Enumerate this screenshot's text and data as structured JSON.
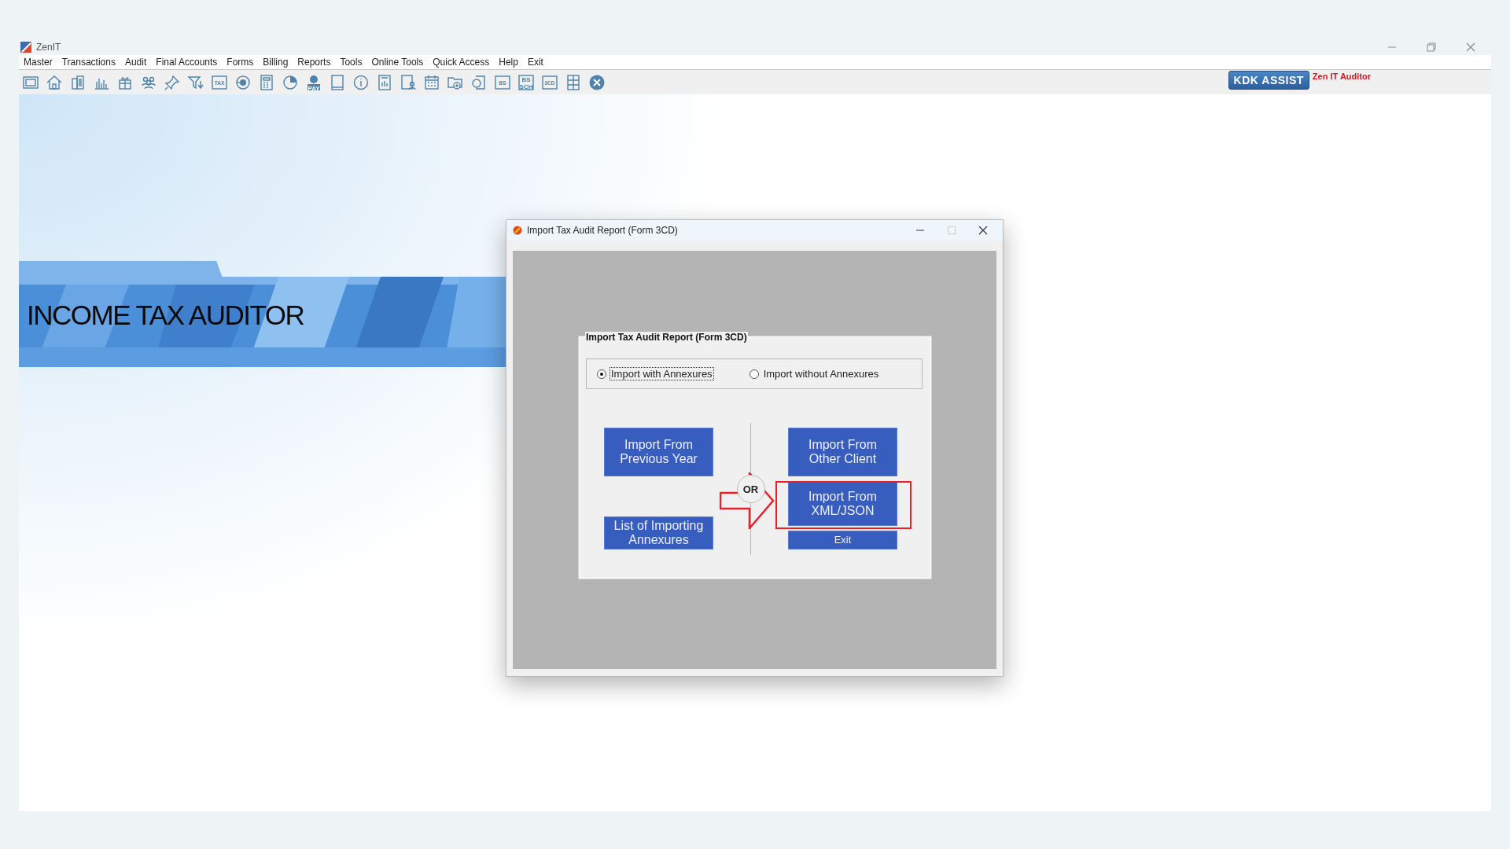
{
  "window": {
    "title": "ZenIT"
  },
  "menu": [
    "Master",
    "Transactions",
    "Audit",
    "Final Accounts",
    "Forms",
    "Billing",
    "Reports",
    "Tools",
    "Online Tools",
    "Quick Access",
    "Help",
    "Exit"
  ],
  "toolbar": [
    {
      "kind": "rupee"
    },
    {
      "kind": "home"
    },
    {
      "kind": "building"
    },
    {
      "kind": "chart"
    },
    {
      "kind": "gift"
    },
    {
      "kind": "people"
    },
    {
      "kind": "pin"
    },
    {
      "kind": "filter"
    },
    {
      "kind": "badge",
      "label": "TAX"
    },
    {
      "kind": "disc"
    },
    {
      "kind": "calculator"
    },
    {
      "kind": "pie"
    },
    {
      "kind": "pay",
      "label": "PAY"
    },
    {
      "kind": "book"
    },
    {
      "kind": "info"
    },
    {
      "kind": "report"
    },
    {
      "kind": "userdoc"
    },
    {
      "kind": "calendar"
    },
    {
      "kind": "folder"
    },
    {
      "kind": "docsearch"
    },
    {
      "kind": "badge",
      "label": "BS"
    },
    {
      "kind": "badge2",
      "label": "BS",
      "sub": "SCH"
    },
    {
      "kind": "badge",
      "label": "3CD"
    },
    {
      "kind": "grid"
    },
    {
      "kind": "close"
    }
  ],
  "assist_button": "KDK ASSIST",
  "product_name": "Zen IT Auditor",
  "banner": {
    "title": "INCOME TAX AUDITOR"
  },
  "dialog": {
    "title": "Import Tax Audit Report (Form 3CD)",
    "group_title": "Import Tax Audit Report (Form 3CD)",
    "options": [
      {
        "label": "Import with Annexures",
        "selected": true
      },
      {
        "label": "Import without Annexures",
        "selected": false
      }
    ],
    "left_buttons": [
      {
        "lines": [
          "Import From",
          "Previous Year"
        ],
        "highlighted": false
      },
      {
        "lines": [
          "List of Importing",
          "Annexures"
        ],
        "highlighted": false
      }
    ],
    "separator_label": "OR",
    "right_buttons": [
      {
        "lines": [
          "Import From",
          "Other Client"
        ],
        "highlighted": false
      },
      {
        "lines": [
          "Import From",
          "XML/JSON"
        ],
        "highlighted": true
      },
      {
        "lines": [
          "Exit"
        ],
        "highlighted": false
      }
    ]
  }
}
